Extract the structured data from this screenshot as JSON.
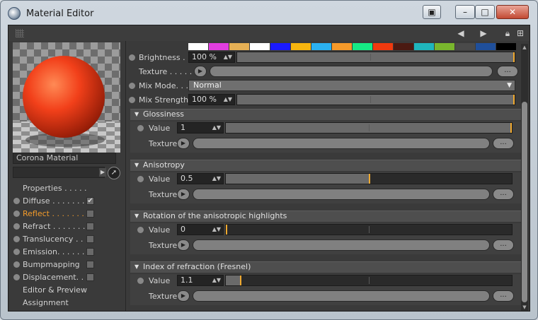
{
  "window": {
    "title": "Material Editor",
    "buttons": {
      "panel": "▣",
      "minimize": "–",
      "maximize": "□",
      "close": "✕"
    }
  },
  "toolbar": {
    "icons": [
      "arrow-back-icon",
      "arrow-forward-icon",
      "lock-icon",
      "new-window-icon"
    ]
  },
  "material": {
    "name": "Corona Material"
  },
  "channels": [
    {
      "label": "Properties . . . . .",
      "dot": false,
      "checkbox": false,
      "checked": false,
      "active": false
    },
    {
      "label": "Diffuse . . . . . . .",
      "dot": true,
      "checkbox": true,
      "checked": true,
      "active": false
    },
    {
      "label": "Reflect . . . . . . . .",
      "dot": true,
      "checkbox": true,
      "checked": false,
      "active": true
    },
    {
      "label": "Refract . . . . . . . .",
      "dot": true,
      "checkbox": true,
      "checked": false,
      "active": false
    },
    {
      "label": "Translucency . . .",
      "dot": true,
      "checkbox": true,
      "checked": false,
      "active": false
    },
    {
      "label": "Emission. . . . . . .",
      "dot": true,
      "checkbox": true,
      "checked": false,
      "active": false
    },
    {
      "label": "Bumpmapping",
      "dot": true,
      "checkbox": true,
      "checked": false,
      "active": false
    },
    {
      "label": "Displacement. . .",
      "dot": true,
      "checkbox": true,
      "checked": false,
      "active": false
    },
    {
      "label": "Editor & Preview",
      "dot": false,
      "checkbox": false,
      "checked": false,
      "active": false
    },
    {
      "label": "Assignment",
      "dot": false,
      "checkbox": false,
      "checked": false,
      "active": false
    }
  ],
  "swatch_colors": [
    "#ffffff",
    "#e23ee0",
    "#e6b055",
    "#ffffff",
    "#1a1aff",
    "#f7b50f",
    "#2bb1f0",
    "#f59a2a",
    "#16ea85",
    "#f0390e",
    "#4b1a12",
    "#1fb6bd",
    "#79b62d",
    "#4a4a4a",
    "#1f4f9b",
    "#000000"
  ],
  "top": {
    "brightness": {
      "label": "Brightness . .",
      "value": "100 %",
      "fraction": 1.0
    },
    "texture_label": "Texture . . . . .",
    "mix_mode": {
      "label": "Mix Mode. . . .",
      "value": "Normal"
    },
    "mix_strength": {
      "label": "Mix Strength",
      "value": "100 %",
      "fraction": 1.0
    }
  },
  "groups": [
    {
      "title": "Glossiness",
      "value_label": "Value",
      "value": "1",
      "fraction": 1.0,
      "texture_label": "Texture"
    },
    {
      "title": "Anisotropy",
      "value_label": "Value",
      "value": "0.5",
      "fraction": 0.5,
      "texture_label": "Texture"
    },
    {
      "title": "Rotation of the anisotropic highlights",
      "value_label": "Value",
      "value": "0",
      "fraction": 0.0,
      "texture_label": "Texture"
    },
    {
      "title": "Index of refraction (Fresnel)",
      "value_label": "Value",
      "value": "1.1",
      "fraction": 0.05,
      "texture_label": "Texture"
    }
  ],
  "more_button": "...",
  "colors": {
    "accent": "#f0a92f",
    "active_label": "#f29b2b",
    "sphere": "#f2401a"
  }
}
